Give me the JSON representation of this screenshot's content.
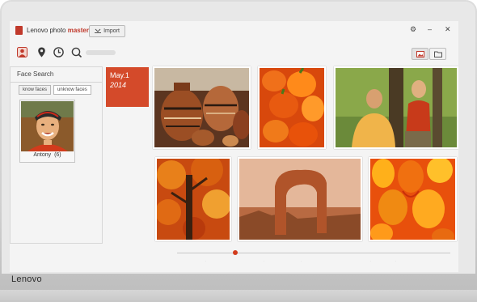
{
  "window": {
    "app_name": "Lenovo photo ",
    "app_name_accent": "master",
    "import_label": "Import"
  },
  "icons": {
    "logo": "photo-logo-icon",
    "import": "import-icon",
    "settings": "gear-icon",
    "people": "people-icon",
    "location": "location-icon",
    "time": "clock-icon",
    "search": "search-icon",
    "image_view": "image-view-icon",
    "folder_view": "folder-icon",
    "minimize": "minimize-icon",
    "close": "close-icon"
  },
  "face_search": {
    "title": "Face Search",
    "tabs": [
      "know faces",
      "unknow faces"
    ],
    "faces": [
      {
        "name": "Antony",
        "count": "(6)"
      }
    ]
  },
  "date": {
    "day": "May.1",
    "year": "2014"
  },
  "device": {
    "brand": "Lenovo"
  },
  "colors": {
    "accent": "#d44a2a",
    "timeline_dot": "#d23b1c"
  }
}
